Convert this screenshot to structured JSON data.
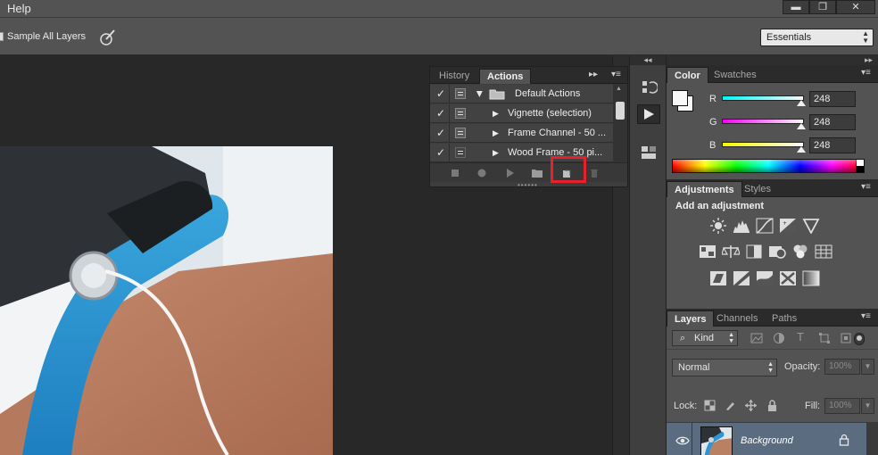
{
  "menubar": {
    "help": "Help",
    "window_buttons": [
      "▬",
      "❐",
      "✕"
    ]
  },
  "options": {
    "sample_all_layers": "Sample All Layers",
    "workspace": "Essentials"
  },
  "actions_panel": {
    "tabs": [
      "History",
      "Actions"
    ],
    "menu_expand": "▸▸",
    "menu": "▾≡",
    "rows": [
      {
        "check": "✓",
        "label": "Default Actions"
      },
      {
        "check": "✓",
        "label": "Vignette (selection)"
      },
      {
        "check": "✓",
        "label": "Frame Channel - 50 ..."
      },
      {
        "check": "✓",
        "label": "Wood Frame - 50 pi..."
      }
    ],
    "toolbar": [
      "stop-icon",
      "record-icon",
      "play-icon",
      "folder-icon",
      "new-action-icon",
      "trash-icon"
    ]
  },
  "dock": {
    "collapse": "◂◂"
  },
  "right": {
    "collapse": "▸▸",
    "color_tabs": [
      "Color",
      "Swatches"
    ],
    "rgb": [
      {
        "label": "R",
        "value": "248",
        "fill": 0.973
      },
      {
        "label": "G",
        "value": "248",
        "fill": 0.973
      },
      {
        "label": "B",
        "value": "248",
        "fill": 0.973
      }
    ],
    "colors": {
      "fg": "#f8f8f8",
      "bg": "#f8f8f8"
    },
    "adj_tabs": [
      "Adjustments",
      "Styles"
    ],
    "adj_title": "Add an adjustment",
    "layers_tabs": [
      "Layers",
      "Channels",
      "Paths"
    ],
    "kind": "Kind",
    "blend_mode": "Normal",
    "opacity_label": "Opacity:",
    "opacity_value": "100%",
    "lock_label": "Lock:",
    "fill_label": "Fill:",
    "fill_value": "100%",
    "layer_name": "Background",
    "panel_menu": "▾≡"
  }
}
